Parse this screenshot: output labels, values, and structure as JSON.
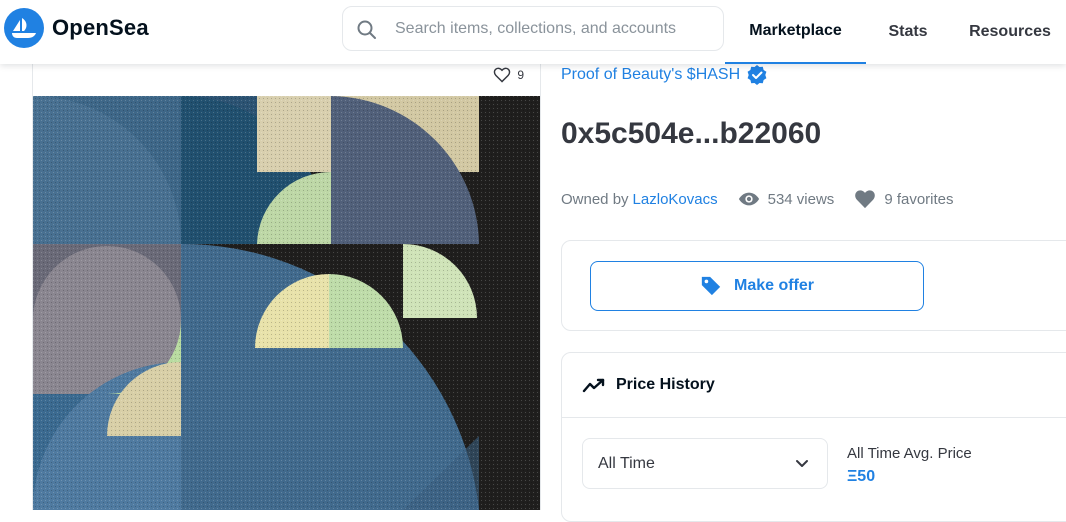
{
  "header": {
    "brand": "OpenSea",
    "search_placeholder": "Search items, collections, and accounts",
    "nav": [
      "Marketplace",
      "Stats",
      "Resources"
    ],
    "active_nav": "Marketplace"
  },
  "asset": {
    "favorite_count": "9",
    "collection_name": "Proof of Beauty's $HASH",
    "title": "0x5c504e...b22060",
    "owned_by_label": "Owned by",
    "owner": "LazloKovacs",
    "views": "534 views",
    "favorites": "9 favorites"
  },
  "offer": {
    "button_label": "Make offer"
  },
  "price_history": {
    "title": "Price History",
    "range_selected": "All Time",
    "avg_label": "All Time Avg. Price",
    "avg_value": "Ξ50"
  },
  "colors": {
    "accent": "#2081e2",
    "text": "#353840",
    "muted": "#707a83",
    "border": "#e5e8eb"
  }
}
